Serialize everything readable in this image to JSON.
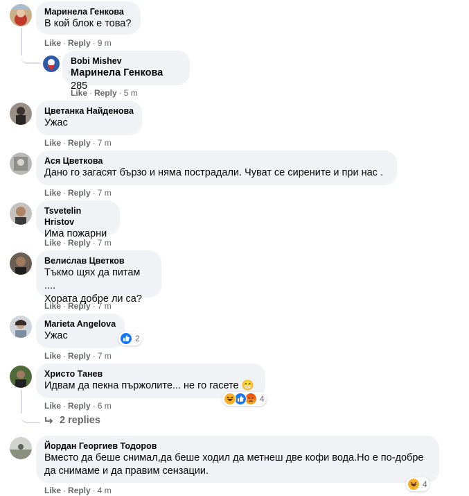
{
  "comments": [
    {
      "author": "Маринела Генкова",
      "text": "В кой блок е това?",
      "like": "Like",
      "reply": "Reply",
      "time": "9 m"
    },
    {
      "author": "Bobi Mishev",
      "mention": "Маринела Генкова",
      "text": " 285",
      "like": "Like",
      "reply": "Reply",
      "time": "5 m"
    },
    {
      "author": "Цветанка Найденова",
      "text": "Ужас",
      "like": "Like",
      "reply": "Reply",
      "time": "7 m"
    },
    {
      "author": "Ася Цветкова",
      "text": "Дано го загасят бързо и няма пострадали. Чуват се сирените и при нас .",
      "like": "Like",
      "reply": "Reply",
      "time": "7 m"
    },
    {
      "author": "Tsvetelin Hristov",
      "text": "Има пожарни",
      "like": "Like",
      "reply": "Reply",
      "time": "7 m"
    },
    {
      "author": "Велислав Цветков",
      "text_lines": [
        "Тъкмо щях да питам ....",
        "Хората добре ли са?"
      ],
      "like": "Like",
      "reply": "Reply",
      "time": "7 m"
    },
    {
      "author": "Marieta Angelova",
      "text": "Ужас",
      "reactions": [
        "like-icon"
      ],
      "reaction_count": "2",
      "like": "Like",
      "reply": "Reply",
      "time": "7 m"
    },
    {
      "author": "Христо Танев",
      "text": "Идвам да пекна пържолите... не го гасете 😁",
      "reactions": [
        "haha-icon",
        "like-icon",
        "angry-icon"
      ],
      "reaction_count": "4",
      "like": "Like",
      "reply": "Reply",
      "time": "6 m"
    },
    {
      "author": "Йордан Георгиев Тодоров",
      "text_lines": [
        "Вместо да беше снимал,да беше ходил да метнеш две кофи вода.Но е по-добре",
        "да снимаме и да правим сензации."
      ],
      "reactions": [
        "haha-icon"
      ],
      "reaction_count": "4",
      "like": "Like",
      "reply": "Reply",
      "time": "4 m"
    }
  ],
  "replies_link": "2 replies",
  "colors": {
    "bubble": "#f0f2f5",
    "meta": "#65676b",
    "like": "#1877f2",
    "haha": "#f7b125",
    "angry": "#e9710f"
  }
}
